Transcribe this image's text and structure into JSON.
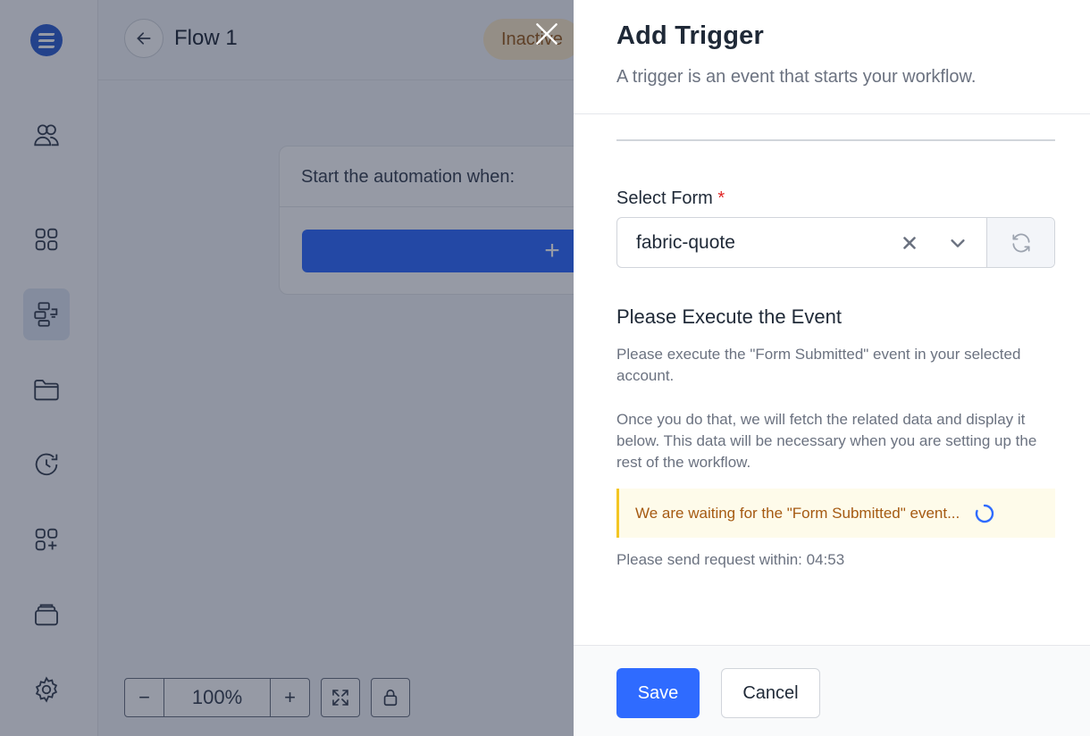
{
  "app": {
    "flow_title": "Flow 1",
    "status": "Inactive",
    "card_heading": "Start the automation when:",
    "card_add_symbol": "+",
    "zoom": {
      "minus": "−",
      "value": "100%",
      "plus": "+"
    }
  },
  "sidebar": {
    "items": [
      {
        "icon": "users-icon"
      },
      {
        "icon": "grid-icon"
      },
      {
        "icon": "workflow-icon",
        "active": true
      },
      {
        "icon": "folder-icon"
      },
      {
        "icon": "history-icon"
      },
      {
        "icon": "add-app-icon"
      },
      {
        "icon": "archive-icon"
      },
      {
        "icon": "settings-icon"
      }
    ]
  },
  "drawer": {
    "title": "Add Trigger",
    "subtitle": "A trigger is an event that starts your workflow.",
    "select_form_label": "Select Form",
    "required_mark": "*",
    "selected_form": "fabric-quote",
    "execute_title": "Please Execute the Event",
    "execute_para1": "Please execute the \"Form Submitted\" event in your selected account.",
    "execute_para2": "Once you do that, we will fetch the related data and display it below. This data will be necessary when you are setting up the rest of the workflow.",
    "waiting_notice": "We are waiting for the \"Form Submitted\" event...",
    "timer_text": "Please send request within: 04:53",
    "save_label": "Save",
    "cancel_label": "Cancel"
  },
  "colors": {
    "primary": "#2f6bff",
    "notice_bg": "#fefbea",
    "notice_border": "#f3c623",
    "notice_text": "#a55a12",
    "required": "#e02424"
  }
}
